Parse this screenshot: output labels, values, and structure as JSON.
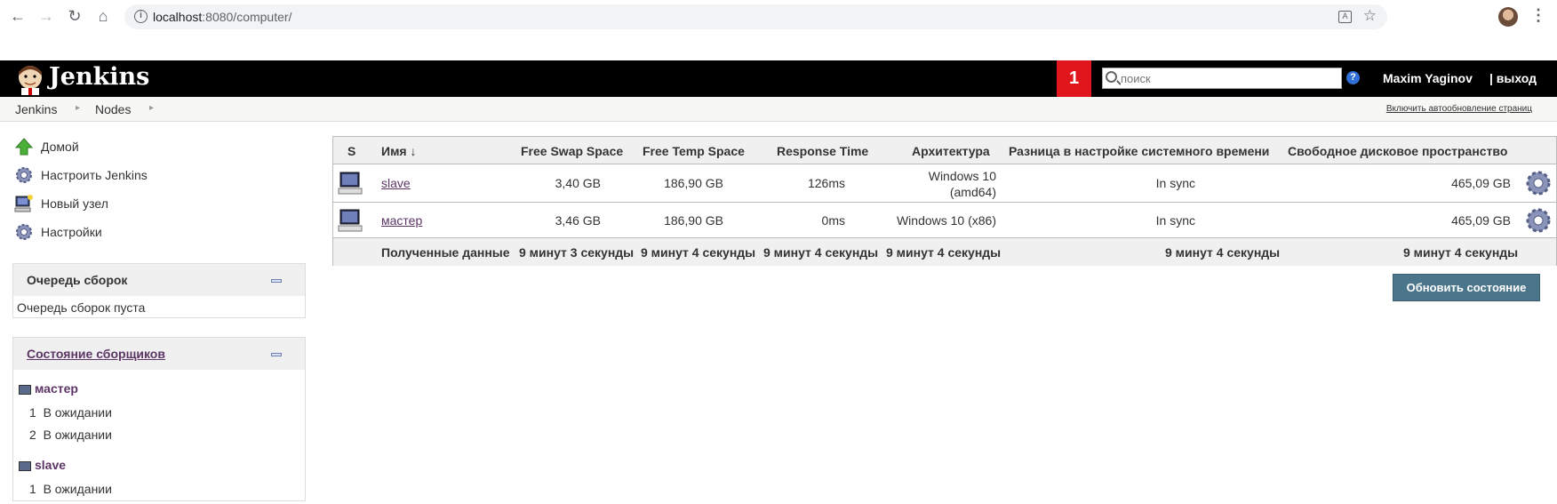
{
  "browser": {
    "url_host": "localhost",
    "url_rest": ":8080/computer/"
  },
  "header": {
    "brand": "Jenkins",
    "notification_count": "1",
    "search_placeholder": "поиск",
    "user": "Maxim Yaginov",
    "logout": "| выход"
  },
  "breadcrumbs": {
    "items": [
      "Jenkins",
      "Nodes"
    ],
    "autorefresh": "Включить автообновление страниц"
  },
  "sidebar": {
    "tasks": [
      {
        "label": "Домой",
        "icon": "home-arrow-icon"
      },
      {
        "label": "Настроить Jenkins",
        "icon": "gear-icon"
      },
      {
        "label": "Новый узел",
        "icon": "computer-new-icon"
      },
      {
        "label": "Настройки",
        "icon": "gear-icon"
      }
    ],
    "queue": {
      "title": "Очередь сборок",
      "empty": "Очередь сборок пуста"
    },
    "executors": {
      "title": "Состояние сборщиков",
      "nodes": [
        {
          "name": "мастер",
          "executors": [
            {
              "num": "1",
              "state": "В ожидании"
            },
            {
              "num": "2",
              "state": "В ожидании"
            }
          ]
        },
        {
          "name": "slave",
          "executors": [
            {
              "num": "1",
              "state": "В ожидании"
            }
          ]
        }
      ]
    }
  },
  "table": {
    "headers": {
      "s": "S",
      "name": "Имя",
      "sort_arrow": "↓",
      "swap": "Free Swap Space",
      "temp": "Free Temp Space",
      "response": "Response Time",
      "arch": "Архитектура",
      "clock": "Разница в настройке системного времени",
      "disk": "Свободное дисковое пространство"
    },
    "rows": [
      {
        "name": "slave",
        "swap": "3,40 GB",
        "temp": "186,90 GB",
        "response": "126ms",
        "arch_line1": "Windows 10",
        "arch_line2": "(amd64)",
        "clock": "In sync",
        "disk": "465,09 GB"
      },
      {
        "name": "мастер",
        "swap": "3,46 GB",
        "temp": "186,90 GB",
        "response": "0ms",
        "arch_line1": "Windows 10 (x86)",
        "clock": "In sync",
        "disk": "465,09 GB"
      }
    ],
    "footer": {
      "label": "Полученные данные",
      "swap": "9 минут 3 секунды",
      "temp": "9 минут 4 секунды",
      "response": "9 минут 4 секунды",
      "arch": "9 минут 4 секунды",
      "clock": "9 минут 4 секунды",
      "disk": "9 минут 4 секунды"
    }
  },
  "refresh_button": "Обновить состояние",
  "colors": {
    "header_bg": "#000000",
    "notification": "#e0161c",
    "link": "#5c3566",
    "button": "#4b758b"
  }
}
